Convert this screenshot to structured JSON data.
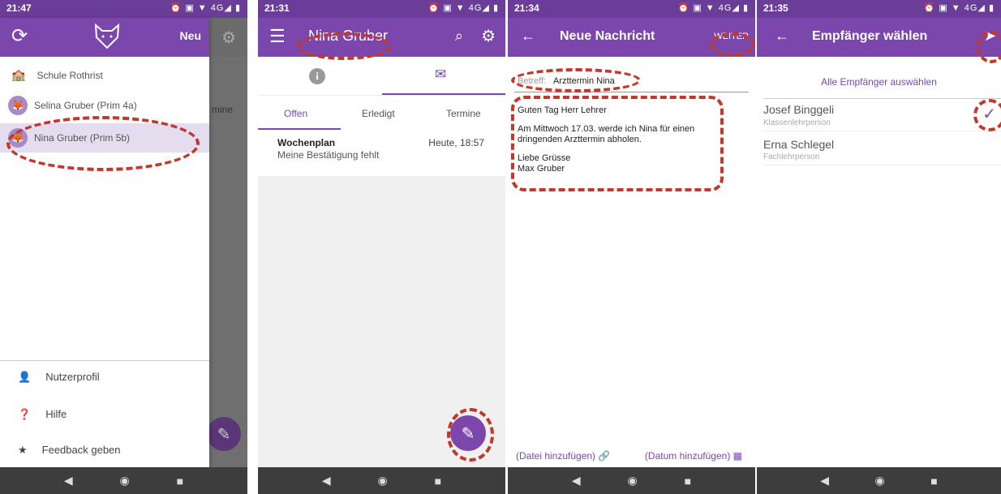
{
  "s1": {
    "time": "21:47",
    "new_label": "Neu",
    "peek_tab": "mine",
    "school": "Schule Rothrist",
    "children": [
      "Selina Gruber (Prim 4a)",
      "Nina Gruber (Prim 5b)"
    ],
    "menu": [
      "Nutzerprofil",
      "Hilfe",
      "Feedback geben"
    ]
  },
  "s2": {
    "time": "21:31",
    "title": "Nina Gruber",
    "tabs": [
      "Offen",
      "Erledigt",
      "Termine"
    ],
    "item_title": "Wochenplan",
    "item_time": "Heute, 18:57",
    "item_sub": "Meine Bestätigung fehlt"
  },
  "s3": {
    "time": "21:34",
    "title": "Neue Nachricht",
    "next": "WEITER",
    "subject_label": "Betreff:",
    "subject_value": "Arzttermin Nina",
    "body": [
      "Guten Tag Herr Lehrer",
      "Am Mittwoch 17.03. werde ich Nina für einen dringenden Arzttermin abholen.",
      "Liebe Grüsse",
      "Max Gruber"
    ],
    "attach": "(Datei hinzufügen)",
    "date": "(Datum hinzufügen)"
  },
  "s4": {
    "time": "21:35",
    "title": "Empfänger wählen",
    "select_all": "Alle Empfänger auswählen",
    "recipients": [
      {
        "name": "Josef Binggeli",
        "role": "Klassenlehrperson"
      },
      {
        "name": "Erna Schlegel",
        "role": "Fachlehrperson"
      }
    ]
  },
  "status_icons": "⏰ ▣ ▼ 4G◢ ▮",
  "nav": [
    "◀",
    "◉",
    "■"
  ],
  "colors": {
    "primary": "#7b47ad",
    "dark": "#6a3e98",
    "highlight": "#e4dcef",
    "annotation": "#c0392b"
  }
}
